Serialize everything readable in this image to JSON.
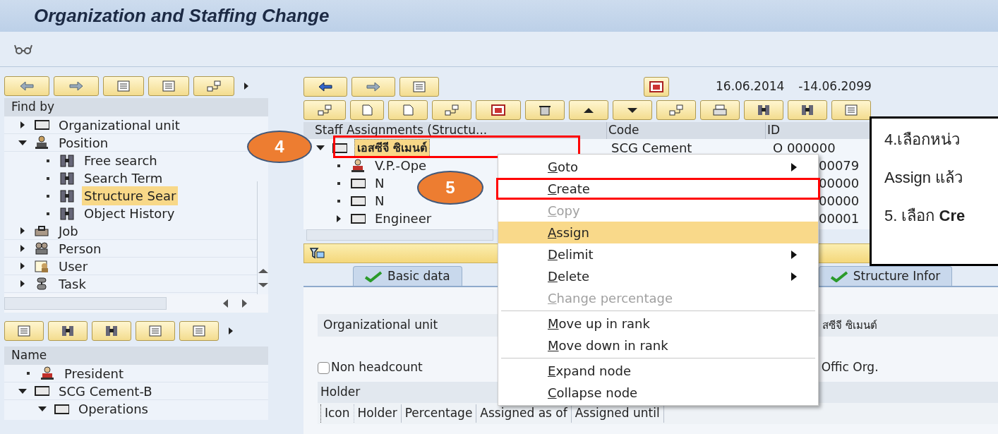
{
  "window": {
    "title": "Organization and Staffing Change"
  },
  "find_by": {
    "header": "Find by",
    "tree": [
      {
        "label": "Organizational unit",
        "kind": "org",
        "expanded": false
      },
      {
        "label": "Position",
        "kind": "position",
        "expanded": true,
        "children": [
          {
            "label": "Free search",
            "kind": "search",
            "selected": false
          },
          {
            "label": "Search Term",
            "kind": "search",
            "selected": false
          },
          {
            "label": "Structure Sear",
            "kind": "search",
            "selected": true
          },
          {
            "label": "Object History",
            "kind": "search",
            "selected": false
          }
        ]
      },
      {
        "label": "Job",
        "kind": "job",
        "expanded": false
      },
      {
        "label": "Person",
        "kind": "person",
        "expanded": false
      },
      {
        "label": "User",
        "kind": "user",
        "expanded": false
      },
      {
        "label": "Task",
        "kind": "task",
        "expanded": false
      }
    ]
  },
  "name_list": {
    "header": "Name",
    "tree": [
      {
        "label": "President",
        "kind": "holder"
      },
      {
        "label": "SCG Cement-B",
        "kind": "org",
        "expanded": true,
        "children": [
          {
            "label": "Operations",
            "kind": "org",
            "expanded": true
          }
        ]
      }
    ]
  },
  "validity": {
    "from": "16.06.2014",
    "to": "-14.06.2099"
  },
  "staff": {
    "columns": [
      "Staff Assignments (Structu...",
      "Code",
      "ID"
    ],
    "rows": [
      {
        "name": "เอสซีจี ซิเมนต์",
        "kind": "org",
        "expanded": true,
        "selected": true,
        "code": "SCG Cement",
        "id": "O 000000"
      },
      {
        "name": "V.P.-Ope",
        "kind": "holder",
        "selected": false,
        "id": "00079"
      },
      {
        "name": "N",
        "kind": "org",
        "selected": false,
        "id": "00000"
      },
      {
        "name": "N",
        "kind": "org",
        "selected": false,
        "id": "00000"
      },
      {
        "name": "Engineer",
        "kind": "org",
        "expanded": false,
        "selected": false,
        "id": "00001"
      }
    ]
  },
  "tabs": [
    {
      "label": "Basic data"
    },
    {
      "label": "Structure Infor"
    }
  ],
  "details": {
    "org_unit_label": "Organizational unit",
    "org_unit_value": "สซีจี ซิเมนต์",
    "non_headcount": {
      "label": "Non headcount",
      "checked": false
    },
    "offic_org_label": "Offic Org.",
    "holder_title": "Holder",
    "holder_columns": [
      "Icon",
      "Holder",
      "Percentage",
      "Assigned as of",
      "Assigned until"
    ]
  },
  "context_menu": [
    {
      "label": "Goto",
      "disabled": false,
      "selected": false,
      "submenu": true,
      "framed": false
    },
    {
      "label": "Create",
      "disabled": false,
      "selected": false,
      "submenu": false,
      "framed": true
    },
    {
      "label": "Copy",
      "disabled": true,
      "selected": false,
      "submenu": false,
      "framed": false
    },
    {
      "label": "Assign",
      "disabled": false,
      "selected": true,
      "submenu": false,
      "framed": false
    },
    {
      "label": "Delimit",
      "disabled": false,
      "selected": false,
      "submenu": true,
      "framed": false
    },
    {
      "label": "Delete",
      "disabled": false,
      "selected": false,
      "submenu": true,
      "framed": false
    },
    {
      "label": "Change percentage",
      "disabled": true,
      "selected": false,
      "submenu": false,
      "framed": false
    },
    {
      "label": "Move up in rank",
      "disabled": false,
      "selected": false,
      "submenu": false,
      "framed": false,
      "separator_before": true
    },
    {
      "label": "Move down in rank",
      "disabled": false,
      "selected": false,
      "submenu": false,
      "framed": false
    },
    {
      "label": "Expand node",
      "disabled": false,
      "selected": false,
      "submenu": false,
      "framed": false,
      "separator_before": true
    },
    {
      "label": "Collapse node",
      "disabled": false,
      "selected": false,
      "submenu": false,
      "framed": false
    }
  ],
  "callouts": [
    "4",
    "5"
  ],
  "note": {
    "lines": [
      "4.เลือกหน่ว",
      "Assign แล้ว",
      "5. เลือก **Cre**"
    ]
  }
}
